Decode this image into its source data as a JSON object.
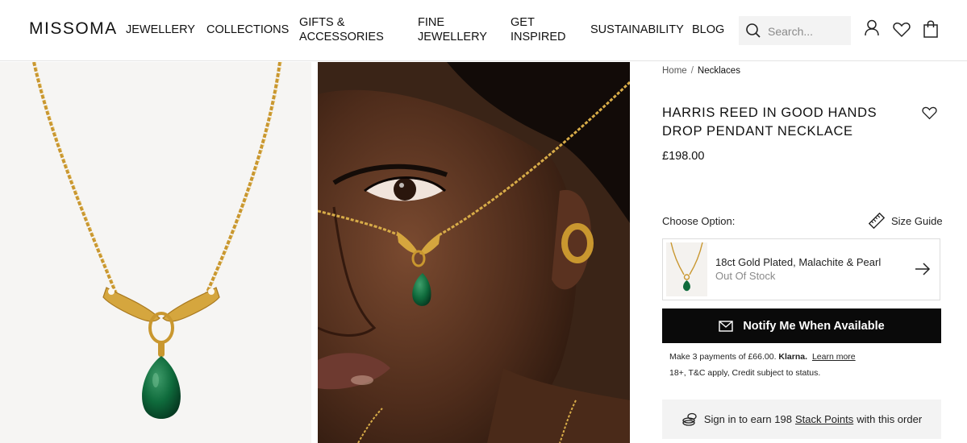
{
  "header": {
    "logo": "MISSOMA",
    "nav": [
      {
        "label": "JEWELLERY"
      },
      {
        "label": "COLLECTIONS"
      },
      {
        "line1": "GIFTS &",
        "line2": "ACCESSORIES"
      },
      {
        "line1": "FINE",
        "line2": "JEWELLERY"
      },
      {
        "line1": "GET",
        "line2": "INSPIRED"
      },
      {
        "label": "SUSTAINABILITY"
      },
      {
        "label": "BLOG"
      }
    ],
    "search": {
      "placeholder": "Search..."
    },
    "icons": [
      "search-icon",
      "account-icon",
      "wishlist-heart-icon",
      "bag-icon"
    ]
  },
  "breadcrumb": {
    "home": "Home",
    "separator": "/",
    "current": "Necklaces"
  },
  "product": {
    "title_line1": "HARRIS REED IN GOOD HANDS",
    "title_line2": "DROP PENDANT NECKLACE",
    "price": "£198.00"
  },
  "options": {
    "label": "Choose Option:",
    "size_guide": "Size Guide",
    "selected": {
      "name": "18ct Gold Plated, Malachite & Pearl",
      "status": "Out Of Stock"
    }
  },
  "cta": {
    "notify_label": "Notify Me When Available"
  },
  "klarna": {
    "text": "Make 3 payments of £66.00.",
    "brand": "Klarna.",
    "link": "Learn more",
    "terms": "18+, T&C apply, Credit subject to status."
  },
  "loyalty": {
    "prefix": "Sign in to earn 198",
    "link": "Stack Points",
    "suffix": "with this order"
  },
  "colors": {
    "accent_black": "#0a0a0a",
    "gold": "#c9972f",
    "malachite": "#0f6b3c",
    "panel_grey": "#f3f3f3"
  }
}
